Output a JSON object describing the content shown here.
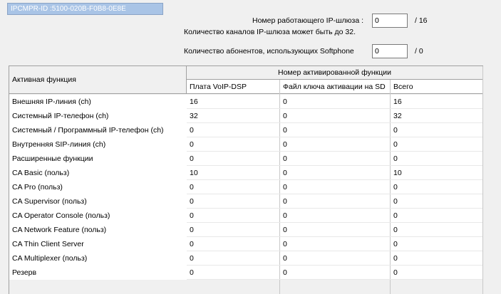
{
  "header": {
    "id_label": "IPCMPR-ID :5100-020B-F0B8-0E8E",
    "gateway_label": "Номер работающего IP-шлюза :",
    "gateway_value": "0",
    "gateway_max": "/ 16",
    "gateway_note": "Количество каналов IP-шлюза может быть до 32.",
    "softphone_label": "Количество абонентов, использующих Softphone",
    "softphone_value": "0",
    "softphone_max": "/ 0"
  },
  "table": {
    "col_function": "Активная функция",
    "col_group": "Номер активированной функции",
    "col_dsp": "Плата VoIP-DSP",
    "col_keyfile": "Файл ключа активации на SD",
    "col_total": "Всего",
    "rows": [
      {
        "name": "Внешняя IP-линия (ch)",
        "dsp": "16",
        "key": "0",
        "total": "16"
      },
      {
        "name": "Системный IP-телефон (ch)",
        "dsp": "32",
        "key": "0",
        "total": "32"
      },
      {
        "name": "Системный / Программный IP-телефон (ch)",
        "dsp": "0",
        "key": "0",
        "total": "0"
      },
      {
        "name": "Внутренняя SIP-линия (ch)",
        "dsp": "0",
        "key": "0",
        "total": "0"
      },
      {
        "name": "Расширенные функции",
        "dsp": "0",
        "key": "0",
        "total": "0"
      },
      {
        "name": "CA Basic (польз)",
        "dsp": "10",
        "key": "0",
        "total": "10"
      },
      {
        "name": "CA Pro (польз)",
        "dsp": "0",
        "key": "0",
        "total": "0"
      },
      {
        "name": "CA Supervisor (польз)",
        "dsp": "0",
        "key": "0",
        "total": "0"
      },
      {
        "name": "CA Operator Console (польз)",
        "dsp": "0",
        "key": "0",
        "total": "0"
      },
      {
        "name": "CA Network Feature (польз)",
        "dsp": "0",
        "key": "0",
        "total": "0"
      },
      {
        "name": "CA Thin Client Server",
        "dsp": "0",
        "key": "0",
        "total": "0"
      },
      {
        "name": "CA Multiplexer (польз)",
        "dsp": "0",
        "key": "0",
        "total": "0"
      },
      {
        "name": "Резерв",
        "dsp": "0",
        "key": "0",
        "total": "0"
      }
    ]
  }
}
